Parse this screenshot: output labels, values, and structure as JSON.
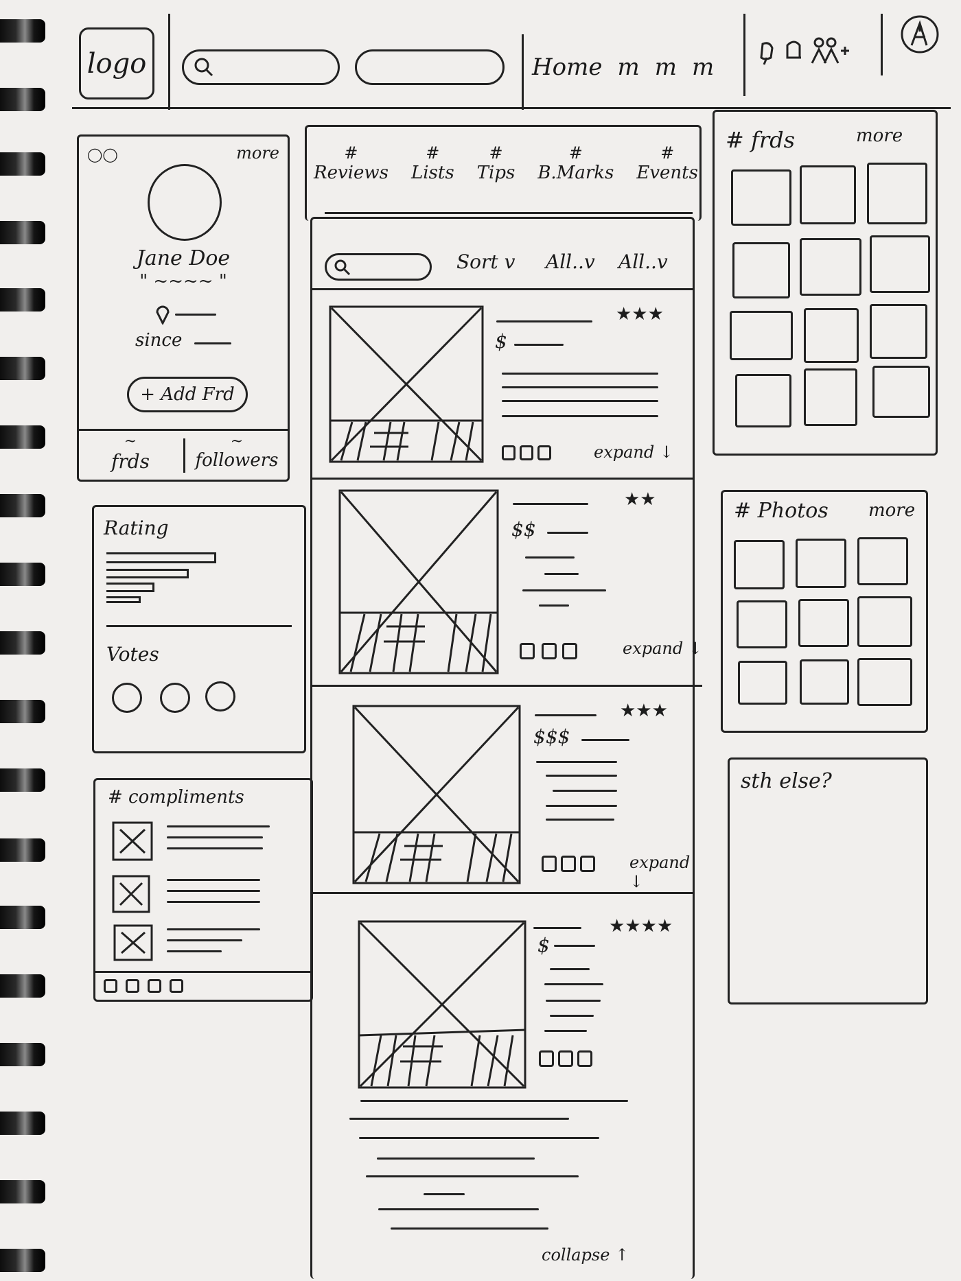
{
  "header": {
    "logo": "logo",
    "nav": [
      "Home",
      "m",
      "m",
      "m"
    ]
  },
  "profile": {
    "more": "more",
    "name": "Jane Doe",
    "quote": "\" ~~~~ \"",
    "since": "since",
    "add_friend": "+ Add Frd",
    "stats": [
      {
        "count": "~",
        "label": "frds"
      },
      {
        "count": "~",
        "label": "followers"
      }
    ]
  },
  "rating_panel": {
    "rating_label": "Rating",
    "votes_label": "Votes"
  },
  "compliments": {
    "title": "# compliments"
  },
  "tabs": [
    {
      "hash": "#",
      "label": "Reviews"
    },
    {
      "hash": "#",
      "label": "Lists"
    },
    {
      "hash": "#",
      "label": "Tips"
    },
    {
      "hash": "#",
      "label": "B.Marks"
    },
    {
      "hash": "#",
      "label": "Events"
    }
  ],
  "filters": {
    "sort": "Sort v",
    "all1": "All..v",
    "all2": "All..v"
  },
  "reviews": [
    {
      "stars": "★★★",
      "price": "$",
      "expand": "expand ↓"
    },
    {
      "stars": "★★",
      "price": "$$",
      "expand": "expand ↓"
    },
    {
      "stars": "★★★",
      "price": "$$$",
      "expand": "expand ↓"
    },
    {
      "stars": "★★★★",
      "price": "$",
      "collapse": "collapse ↑"
    }
  ],
  "friends": {
    "title": "# frds",
    "more": "more"
  },
  "photos": {
    "title": "# Photos",
    "more": "more"
  },
  "something": {
    "title": "sth else?"
  }
}
